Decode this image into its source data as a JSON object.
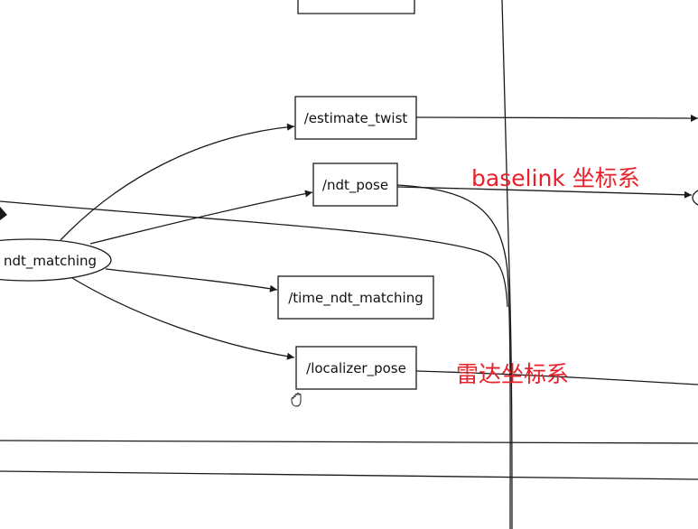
{
  "node": {
    "label": "ndt_matching"
  },
  "topics": {
    "estimate_twist": "/estimate_twist",
    "ndt_pose": "/ndt_pose",
    "time_ndt_matching": "/time_ndt_matching",
    "localizer_pose": "/localizer_pose"
  },
  "annotations": {
    "baselink": "baselink 坐标系",
    "lidar": "雷达坐标系"
  },
  "colors": {
    "annotation": "#e8202a",
    "line": "#1a1a1a"
  },
  "cursor": {
    "icon": "hand-grab-icon"
  }
}
